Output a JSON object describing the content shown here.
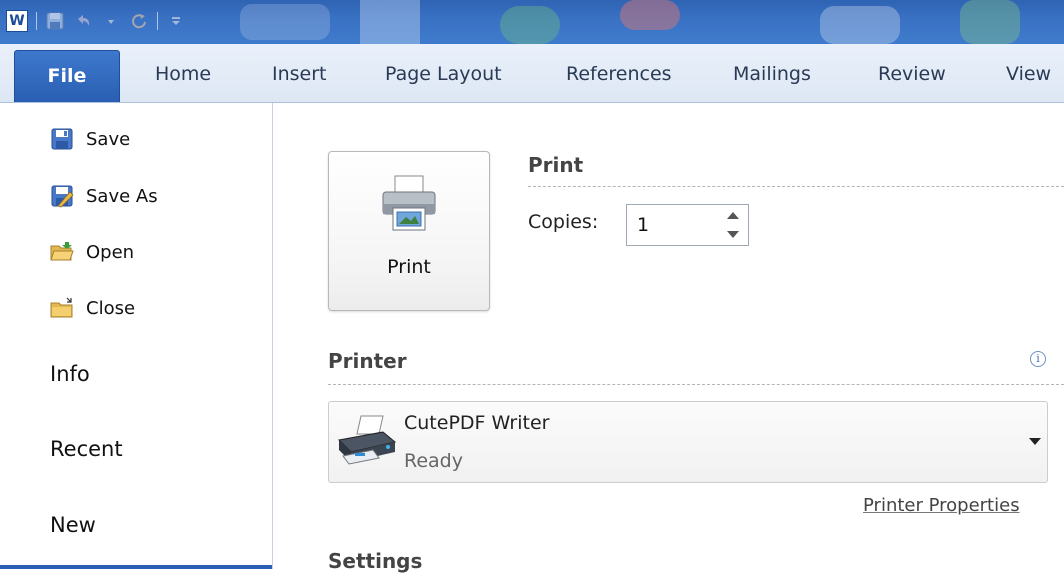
{
  "ribbon": {
    "tabs": [
      {
        "label": "File",
        "active": true
      },
      {
        "label": "Home"
      },
      {
        "label": "Insert"
      },
      {
        "label": "Page Layout"
      },
      {
        "label": "References"
      },
      {
        "label": "Mailings"
      },
      {
        "label": "Review"
      },
      {
        "label": "View"
      }
    ]
  },
  "quick_access": {
    "app_icon": "word-icon",
    "buttons": [
      "save-icon",
      "undo-icon",
      "redo-icon",
      "customize-icon"
    ]
  },
  "backstage_nav": {
    "commands": [
      {
        "label": "Save",
        "icon": "save-icon"
      },
      {
        "label": "Save As",
        "icon": "save-as-icon"
      },
      {
        "label": "Open",
        "icon": "open-folder-icon"
      },
      {
        "label": "Close",
        "icon": "close-folder-icon"
      }
    ],
    "tabs": [
      {
        "label": "Info"
      },
      {
        "label": "Recent"
      },
      {
        "label": "New"
      }
    ]
  },
  "print_panel": {
    "print_button_label": "Print",
    "print_title": "Print",
    "copies_label": "Copies:",
    "copies_value": "1",
    "printer_title": "Printer",
    "printer_name": "CutePDF Writer",
    "printer_status": "Ready",
    "printer_properties_link": "Printer Properties",
    "settings_title": "Settings"
  },
  "colors": {
    "file_tab": "#2a5fb3",
    "title_bar": "#3a72c4",
    "nav_accent": "#2a5fb3"
  }
}
